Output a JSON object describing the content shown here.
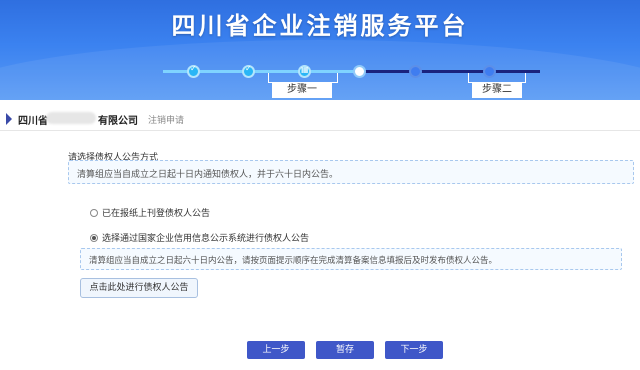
{
  "header": {
    "title": "四川省企业注销服务平台"
  },
  "steps": [
    {
      "label": "步骤一"
    },
    {
      "label": "步骤二"
    }
  ],
  "company": {
    "name_prefix": "四川省",
    "name_suffix": "有限公司",
    "sub": "注销申请"
  },
  "form": {
    "section_title": "请选择债权人公告方式",
    "info": "清算组应当自成立之日起十日内通知债权人，并于六十日内公告。",
    "option1": "已在报纸上刊登债权人公告",
    "option2": "选择通过国家企业信用信息公示系统进行债权人公告",
    "info2": "清算组应当自成立之日起六十日内公告，请按页面提示顺序在完成清算备案信息填报后及时发布债权人公告。",
    "publish_button": "点击此处进行债权人公告",
    "option2_selected": true
  },
  "buttons": {
    "prev": "上一步",
    "save": "暂存",
    "next": "下一步"
  }
}
